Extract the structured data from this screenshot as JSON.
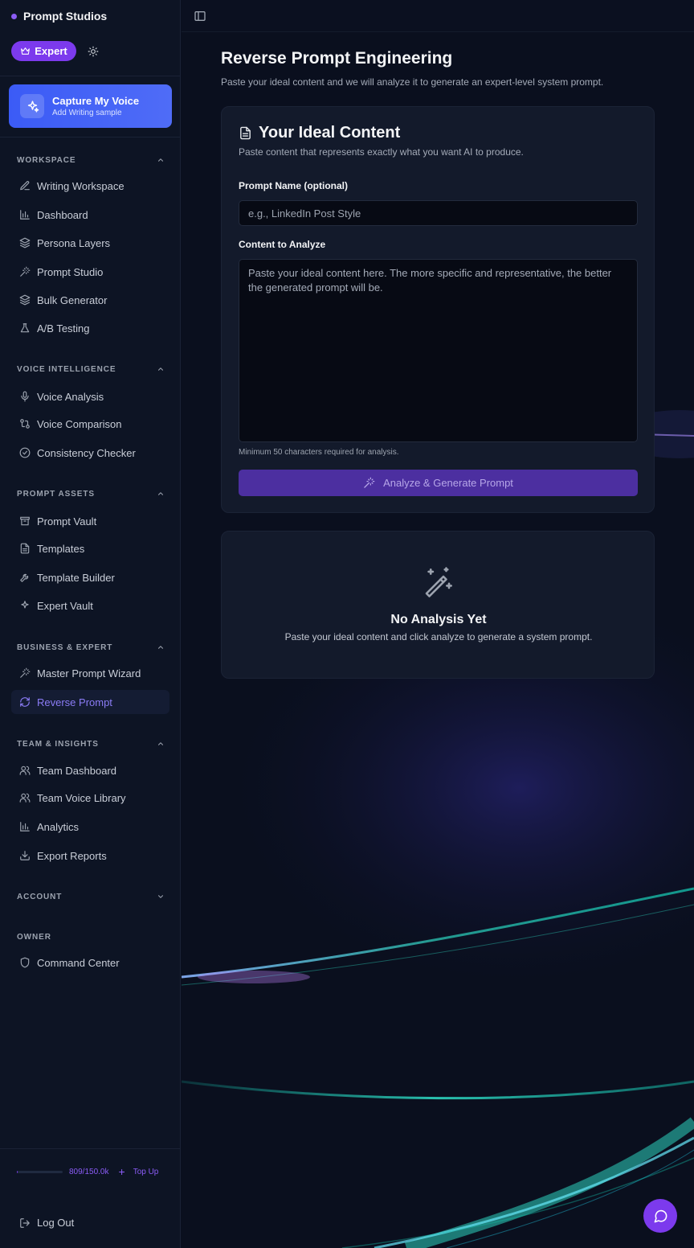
{
  "brand": {
    "name": "Prompt Studios"
  },
  "header": {
    "plan_label": "Expert"
  },
  "capture": {
    "title": "Capture My Voice",
    "subtitle": "Add Writing sample"
  },
  "sidebar": {
    "sections": [
      {
        "title": "WORKSPACE",
        "items": [
          "Writing Workspace",
          "Dashboard",
          "Persona Layers",
          "Prompt Studio",
          "Bulk Generator",
          "A/B Testing"
        ]
      },
      {
        "title": "VOICE INTELLIGENCE",
        "items": [
          "Voice Analysis",
          "Voice Comparison",
          "Consistency Checker"
        ]
      },
      {
        "title": "PROMPT ASSETS",
        "items": [
          "Prompt Vault",
          "Templates",
          "Template Builder",
          "Expert Vault"
        ]
      },
      {
        "title": "BUSINESS & EXPERT",
        "items": [
          "Master Prompt Wizard",
          "Reverse Prompt"
        ]
      },
      {
        "title": "TEAM & INSIGHTS",
        "items": [
          "Team Dashboard",
          "Team Voice Library",
          "Analytics",
          "Export Reports"
        ]
      },
      {
        "title": "ACCOUNT",
        "items": []
      },
      {
        "title": "OWNER",
        "items": [
          "Command Center"
        ]
      }
    ],
    "active_item": "Reverse Prompt",
    "credits": {
      "text": "809/150.0k",
      "used_fraction": 0.0054,
      "topup_label": "Top Up"
    },
    "logout_label": "Log Out"
  },
  "main": {
    "title": "Reverse Prompt Engineering",
    "subtitle": "Paste your ideal content and we will analyze it to generate an expert-level system prompt.",
    "card": {
      "title": "Your Ideal Content",
      "subtitle": "Paste content that represents exactly what you want AI to produce.",
      "name_label": "Prompt Name (optional)",
      "name_placeholder": "e.g., LinkedIn Post Style",
      "name_value": "",
      "content_label": "Content to Analyze",
      "content_placeholder": "Paste your ideal content here. The more specific and representative, the better the generated prompt will be.",
      "content_value": "",
      "hint": "Minimum 50 characters required for analysis.",
      "button_label": "Analyze & Generate Prompt"
    },
    "empty": {
      "title": "No Analysis Yet",
      "subtitle": "Paste your ideal content and click analyze to generate a system prompt."
    }
  },
  "colors": {
    "accent": "#7c3aed",
    "capture": "#4f6cf7",
    "glow": "#14d4d4"
  }
}
